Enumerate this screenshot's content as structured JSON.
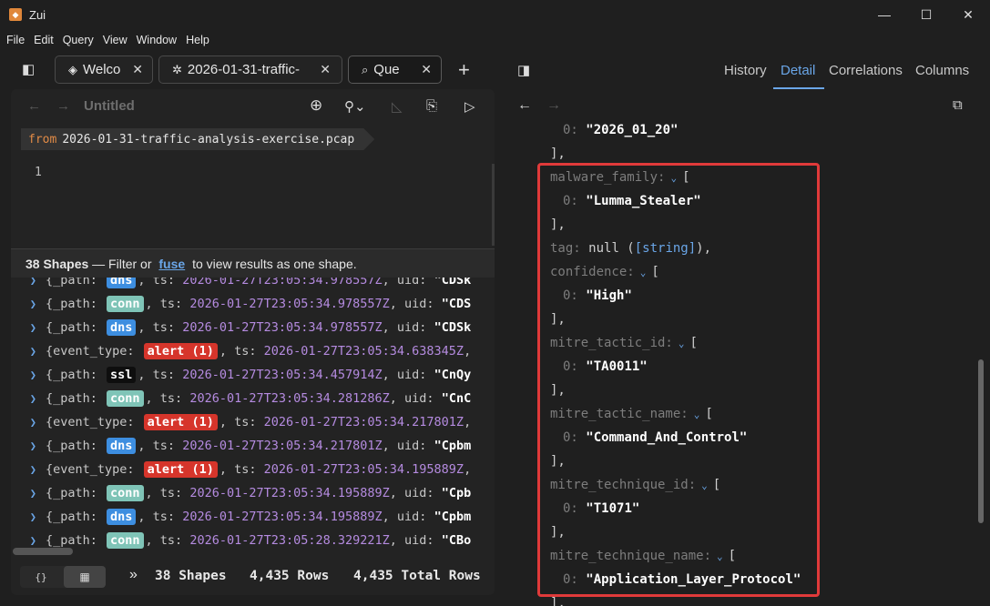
{
  "window": {
    "title": "Zui",
    "minimize": "—",
    "maximize": "☐",
    "close": "✕"
  },
  "menu": [
    "File",
    "Edit",
    "Query",
    "View",
    "Window",
    "Help"
  ],
  "tabs": [
    {
      "label": "Welco",
      "icon": "zui-logo-icon"
    },
    {
      "label": "2026-01-31-traffic-",
      "icon": "pool-icon"
    },
    {
      "label": "Que",
      "icon": "search-icon"
    }
  ],
  "right_tabs": [
    "History",
    "Detail",
    "Correlations",
    "Columns"
  ],
  "editor": {
    "title": "Untitled",
    "from_keyword": "from",
    "from_file": "2026-01-31-traffic-analysis-exercise.pcap",
    "line_number": "1"
  },
  "banner": {
    "count": "38 Shapes",
    "text1": " — Filter or ",
    "link": "fuse",
    "text2": " to view results as one shape."
  },
  "rows": [
    {
      "key": "{_path: ",
      "tag": "dns",
      "tag_type": "dns",
      "ts_key": ", ts: ",
      "ts": "2026-01-27T23:05:34.978557Z",
      "uid_key": ", uid: ",
      "uid": "\"CDSk"
    },
    {
      "key": "{_path: ",
      "tag": "conn",
      "tag_type": "conn",
      "ts_key": ", ts: ",
      "ts": "2026-01-27T23:05:34.978557Z",
      "uid_key": ", uid: ",
      "uid": "\"CDS"
    },
    {
      "key": "{_path: ",
      "tag": "dns",
      "tag_type": "dns",
      "ts_key": ", ts: ",
      "ts": "2026-01-27T23:05:34.978557Z",
      "uid_key": ", uid: ",
      "uid": "\"CDSk"
    },
    {
      "key": "{event_type: ",
      "tag": "alert (1)",
      "tag_type": "alert",
      "ts_key": ", ts: ",
      "ts": "2026-01-27T23:05:34.638345Z",
      "uid_key": ",",
      "uid": ""
    },
    {
      "key": "{_path: ",
      "tag": "ssl",
      "tag_type": "ssl",
      "ts_key": ", ts: ",
      "ts": "2026-01-27T23:05:34.457914Z",
      "uid_key": ", uid: ",
      "uid": "\"CnQy"
    },
    {
      "key": "{_path: ",
      "tag": "conn",
      "tag_type": "conn",
      "ts_key": ", ts: ",
      "ts": "2026-01-27T23:05:34.281286Z",
      "uid_key": ", uid: ",
      "uid": "\"CnC"
    },
    {
      "key": "{event_type: ",
      "tag": "alert (1)",
      "tag_type": "alert",
      "ts_key": ", ts: ",
      "ts": "2026-01-27T23:05:34.217801Z",
      "uid_key": ",",
      "uid": ""
    },
    {
      "key": "{_path: ",
      "tag": "dns",
      "tag_type": "dns",
      "ts_key": ", ts: ",
      "ts": "2026-01-27T23:05:34.217801Z",
      "uid_key": ", uid: ",
      "uid": "\"Cpbm"
    },
    {
      "key": "{event_type: ",
      "tag": "alert (1)",
      "tag_type": "alert",
      "ts_key": ", ts: ",
      "ts": "2026-01-27T23:05:34.195889Z",
      "uid_key": ",",
      "uid": ""
    },
    {
      "key": "{_path: ",
      "tag": "conn",
      "tag_type": "conn",
      "ts_key": ", ts: ",
      "ts": "2026-01-27T23:05:34.195889Z",
      "uid_key": ", uid: ",
      "uid": "\"Cpb"
    },
    {
      "key": "{_path: ",
      "tag": "dns",
      "tag_type": "dns",
      "ts_key": ", ts: ",
      "ts": "2026-01-27T23:05:34.195889Z",
      "uid_key": ", uid: ",
      "uid": "\"Cpbm"
    },
    {
      "key": "{_path: ",
      "tag": "conn",
      "tag_type": "conn",
      "ts_key": ", ts: ",
      "ts": "2026-01-27T23:05:28.329221Z",
      "uid_key": ", uid: ",
      "uid": "\"CBo"
    }
  ],
  "status": {
    "toggle_obj": "{}",
    "toggle_table": "▦",
    "chevron": "»",
    "shapes": "38 Shapes",
    "rows": "4,435 Rows",
    "total": "4,435 Total Rows"
  },
  "detail": {
    "lines": [
      {
        "type": "item",
        "idx": "0:",
        "val": "\"2026_01_20\""
      },
      {
        "type": "close",
        "text": "],"
      },
      {
        "type": "array",
        "key": "malware_family:",
        "open": "["
      },
      {
        "type": "item",
        "idx": "0:",
        "val": "\"Lumma_Stealer\""
      },
      {
        "type": "close",
        "text": "],"
      },
      {
        "type": "null",
        "key": "tag:",
        "null": "null",
        "type_open": " (",
        "type_name": "[string]",
        "type_close": "),"
      },
      {
        "type": "array",
        "key": "confidence:",
        "open": "["
      },
      {
        "type": "item",
        "idx": "0:",
        "val": "\"High\""
      },
      {
        "type": "close",
        "text": "],"
      },
      {
        "type": "array",
        "key": "mitre_tactic_id:",
        "open": "["
      },
      {
        "type": "item",
        "idx": "0:",
        "val": "\"TA0011\""
      },
      {
        "type": "close",
        "text": "],"
      },
      {
        "type": "array",
        "key": "mitre_tactic_name:",
        "open": "["
      },
      {
        "type": "item",
        "idx": "0:",
        "val": "\"Command_And_Control\""
      },
      {
        "type": "close",
        "text": "],"
      },
      {
        "type": "array",
        "key": "mitre_technique_id:",
        "open": "["
      },
      {
        "type": "item",
        "idx": "0:",
        "val": "\"T1071\""
      },
      {
        "type": "close",
        "text": "],"
      },
      {
        "type": "array",
        "key": "mitre_technique_name:",
        "open": "["
      },
      {
        "type": "item",
        "idx": "0:",
        "val": "\"Application_Layer_Protocol\""
      },
      {
        "type": "close",
        "text": "],"
      }
    ]
  },
  "colors": {
    "accent": "#6aa6e8",
    "highlight": "#e03a3a",
    "alert": "#d6352b",
    "conn": "#7fc4b7",
    "dns": "#3d8ee0"
  }
}
